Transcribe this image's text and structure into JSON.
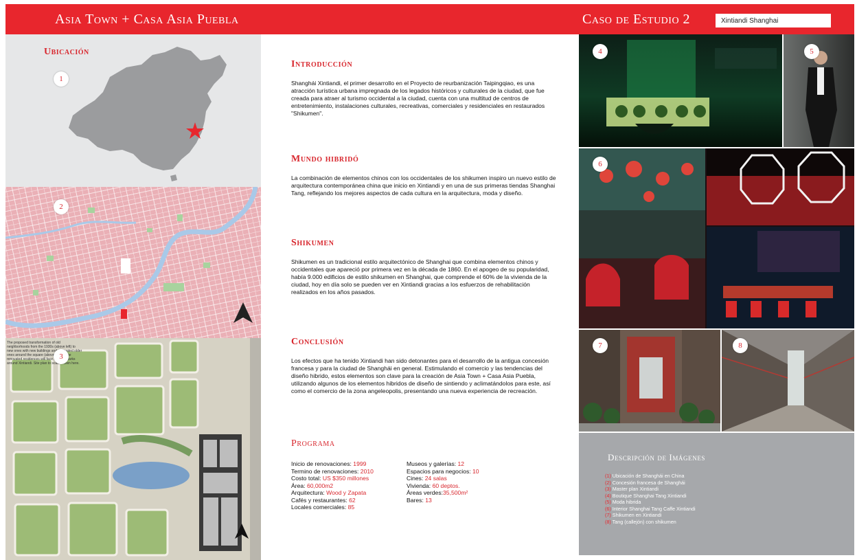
{
  "header": {
    "title": "Asia Town + Casa Asia Puebla",
    "case_title": "Caso de Estudio 2",
    "search_value": "Xintiandi Shanghai"
  },
  "left": {
    "location_label": "Ubicación",
    "badges": [
      "1",
      "2",
      "3"
    ],
    "plan_note": "The proposed transformation of old neighborhoods from the 1930s (above left) to new ones with new buildings and renovated older ones around the square (above right). The renovated residences will face the new parks around Xintiandi. Site plan to scale shown here."
  },
  "middle": {
    "intro": {
      "heading": "Introducción",
      "text": "Shanghái Xintiandi, el primer desarrollo en el Proyecto de reurbanización Taipingqiao, es una atracción turística urbana impregnada de los legados históricos y culturales de la ciudad, que fue creada para atraer al turismo occidental a la ciudad, cuenta con una multitud de centros de entretenimiento, instalaciones culturales, recreativas, comerciales y residenciales en restaurados \"Shikumen\"."
    },
    "mundo": {
      "heading": "Mundo hibridó",
      "text": "La combinación de elementos chinos con los occidentales de los shikumen inspiro un nuevo estilo de arquitectura contemporánea china que inicio en Xintiandi y en una de sus primeras tiendas Shanghai Tang, reflejando los mejores aspectos de cada cultura en la arquitectura, moda y diseño."
    },
    "shikumen": {
      "heading": "Shikumen",
      "text": "Shikumen es un tradicional estilo arquitectónico de Shanghai que combina elementos chinos y occidentales que apareció por primera vez en la década de 1860. En el apogeo de su popularidad, había 9.000 edificios de estilo shikumen en Shanghai, que comprende el 60% de la vivienda de la ciudad, hoy en día solo se pueden ver en Xintiandi gracias a los esfuerzos de rehabilitación realizados en los años pasados."
    },
    "conclusion": {
      "heading": "Conclusión",
      "text": "Los efectos que ha tenido Xintiandi han sido detonantes para el desarrollo de la antigua concesión francesa  y para la ciudad de Shanghái en general. Estimulando el comercio y las tendencias del diseño hibrido, estos elementos son clave para la creación de Asia Town + Casa Asia Puebla, utilizando algunos de los elementos hibridos de diseño de sintiendo y aclimatándolos para este, así como el comercio de la zona angeleopolis, presentando una nueva experiencia de recreación."
    },
    "programa": {
      "heading": "Programa",
      "col1": [
        {
          "label": "Inicio de renovaciones: ",
          "value": "1999"
        },
        {
          "label": "Termino de renovaciones: ",
          "value": "2010"
        },
        {
          "label": "Costo total: ",
          "value": "US $350 millones"
        },
        {
          "label": "Área: ",
          "value": "60,000m2"
        },
        {
          "label": "Arquitectura: ",
          "value": "Wood y Zapata"
        },
        {
          "label": "Cafés y restaurantes: ",
          "value": "62"
        },
        {
          "label": "Locales comerciales: ",
          "value": "85"
        }
      ],
      "col2": [
        {
          "label": "Museos y galerías: ",
          "value": "12"
        },
        {
          "label": "Espacios para negocios: ",
          "value": "10"
        },
        {
          "label": "Cines: ",
          "value": "24 salas"
        },
        {
          "label": "Vivienda: ",
          "value": "60 deptos."
        },
        {
          "label": "Áreas verdes:",
          "value": "35,500m²"
        },
        {
          "label": "Bares: ",
          "value": "13"
        }
      ]
    }
  },
  "right": {
    "badges": [
      "4",
      "5",
      "6",
      "7",
      "8"
    ],
    "desc_title": "Descripción de Imágenes",
    "desc_items": [
      {
        "n": "(1)",
        "t": " Ubicación de Shanghái en China"
      },
      {
        "n": "(2)",
        "t": " Concesión francesa de Shanghái"
      },
      {
        "n": "(3)",
        "t": " Master plan Xintiandi"
      },
      {
        "n": "(4)",
        "t": " Boutique Shanghai Tang Xintiandi"
      },
      {
        "n": "(5)",
        "t": " Moda hibrida"
      },
      {
        "n": "(6)",
        "t": " Interior Shanghai Tang Caffe Xintiandi"
      },
      {
        "n": "(7)",
        "t": " Shikumen en Xintiandi"
      },
      {
        "n": "(8)",
        "t": " Tang (callejón) con shikumen"
      }
    ]
  },
  "colors": {
    "accent": "#e8262d",
    "map_pink": "#eab0b6",
    "river_blue": "#a9c9e8",
    "panel_grey": "#a6a8ab"
  }
}
